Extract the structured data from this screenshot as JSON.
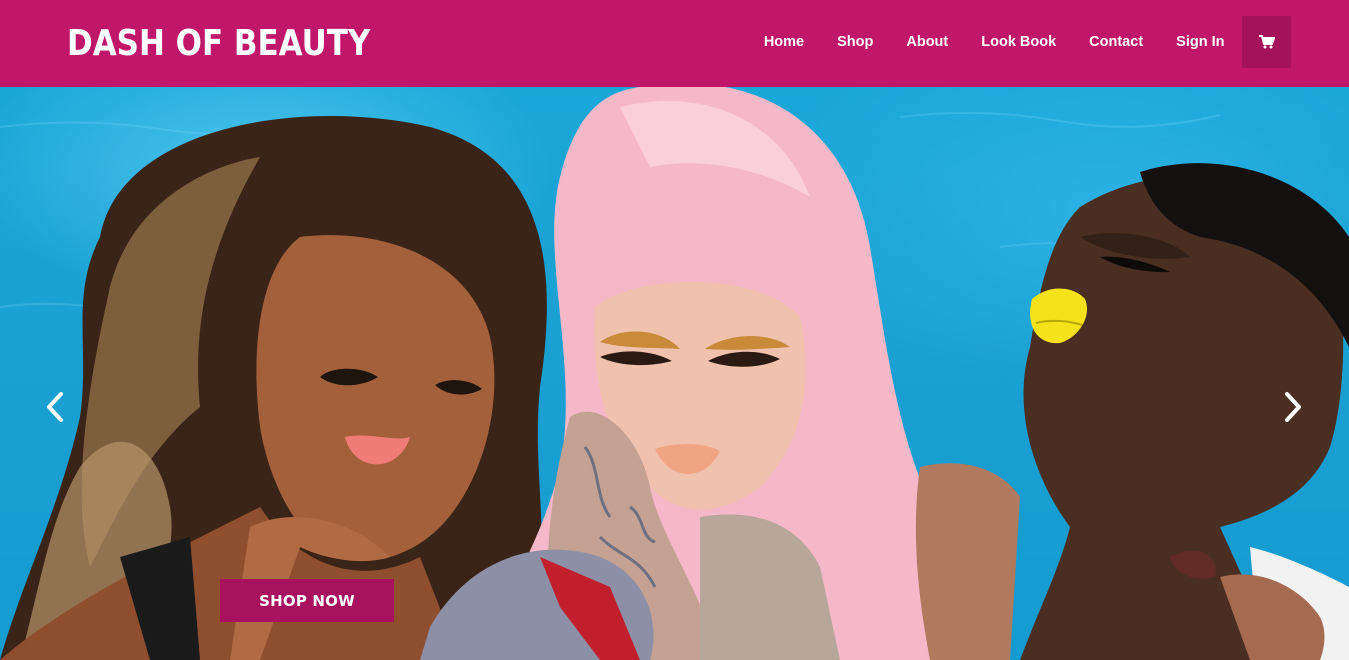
{
  "header": {
    "brand": "DASH OF BEAUTY",
    "nav": [
      {
        "label": "Home"
      },
      {
        "label": "Shop"
      },
      {
        "label": "About"
      },
      {
        "label": "Look Book"
      },
      {
        "label": "Contact"
      },
      {
        "label": "Sign In"
      }
    ],
    "cart_icon": "shopping-cart-icon"
  },
  "hero": {
    "cta_label": "SHOP NOW",
    "prev_icon": "chevron-left-icon",
    "next_icon": "chevron-right-icon",
    "image_description_icon": "hero-photo"
  },
  "colors": {
    "header_bg": "#c0176a",
    "cart_bg": "#a4125b",
    "cta_bg": "#a7115e",
    "hero_water": "#1ba0d2"
  }
}
